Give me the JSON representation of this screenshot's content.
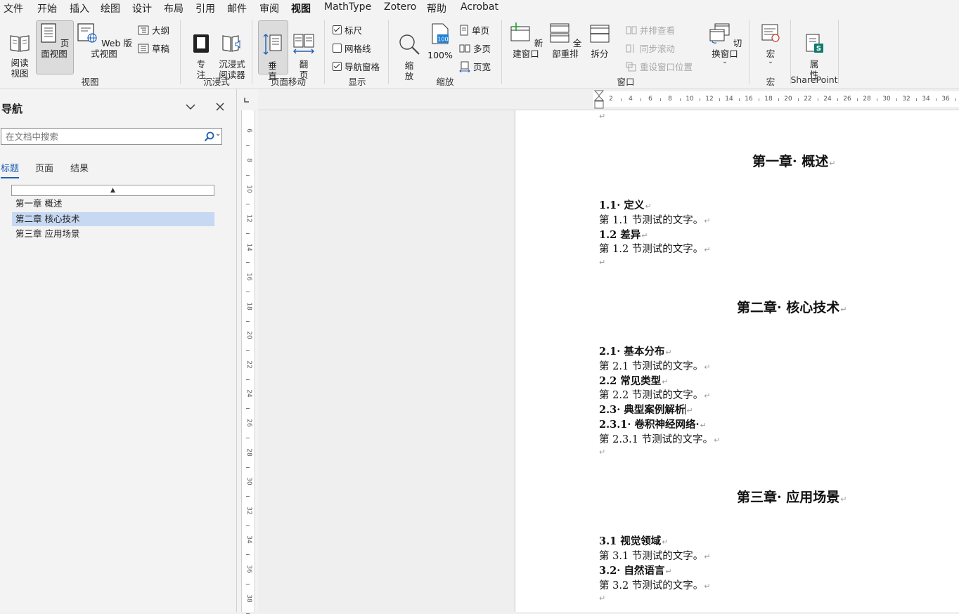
{
  "menu": [
    "文件",
    "开始",
    "插入",
    "绘图",
    "设计",
    "布局",
    "引用",
    "邮件",
    "审阅",
    "视图",
    "MathType",
    "Zotero",
    "帮助",
    "Acrobat"
  ],
  "menu_active_index": 9,
  "ribbon": {
    "view_group": {
      "read_mode": "阅读\n视图",
      "print_layout": "页面视图",
      "web_layout": "Web 版式视图",
      "outline": "大纲",
      "draft": "草稿",
      "label": "视图"
    },
    "immersive_group": {
      "focus": "专\n注",
      "immersive_reader": "沉浸式\n阅读器",
      "label": "沉浸式"
    },
    "page_move_group": {
      "vertical": "垂\n直",
      "side_to_side": "翻\n页",
      "label": "页面移动"
    },
    "show_group": {
      "ruler": "标尺",
      "ruler_checked": true,
      "gridlines": "网格线",
      "gridlines_checked": false,
      "nav_pane": "导航窗格",
      "nav_pane_checked": true,
      "label": "显示"
    },
    "zoom_group": {
      "zoom": "缩\n放",
      "hundred": "100%",
      "hundred_icon": "100",
      "one_page": "单页",
      "multiple_pages": "多页",
      "page_width": "页宽",
      "label": "缩放"
    },
    "window_group": {
      "new_window": "新建窗口",
      "arrange_all": "全部重排",
      "split": "拆分",
      "side_by_side": "并排查看",
      "sync_scroll": "同步滚动",
      "reset_position": "重设窗口位置",
      "switch_windows": "切换窗口",
      "label": "窗口"
    },
    "macro_group": {
      "macros": "宏",
      "label": "宏"
    },
    "sharepoint_group": {
      "properties": "属\n性",
      "label": "SharePoint"
    }
  },
  "nav": {
    "title": "导航",
    "search_placeholder": "在文档中搜索",
    "tabs": [
      "标题",
      "页面",
      "结果"
    ],
    "active_tab": 0,
    "collapse_glyph": "▲",
    "headings": [
      "第一章 概述",
      "第二章 核心技术",
      "第三章 应用场景"
    ],
    "selected_heading": 1
  },
  "vruler_labels": [
    "6",
    "8",
    "10",
    "12",
    "14",
    "16",
    "18",
    "20",
    "22",
    "24",
    "26",
    "28",
    "30",
    "32",
    "34",
    "36",
    "38"
  ],
  "hruler_labels": [
    "2",
    "4",
    "6",
    "8",
    "10",
    "12",
    "14",
    "16",
    "18",
    "20",
    "22",
    "24",
    "26",
    "28",
    "30",
    "32",
    "34",
    "36"
  ],
  "document": {
    "para_mark": "↵",
    "ch1": "第一章· 概述",
    "s1_1": "1.1· 定义",
    "t1_1": "第 1.1 节测试的文字。",
    "s1_2": "1.2 差异",
    "t1_2": "第 1.2 节测试的文字。",
    "ch2": "第二章· 核心技术",
    "s2_1": "2.1· 基本分布",
    "t2_1": "第 2.1 节测试的文字。",
    "s2_2": "2.2 常见类型",
    "t2_2": "第 2.2 节测试的文字。",
    "s2_3": "2.3· 典型案例解析",
    "s2_3_1": "2.3.1· 卷积神经网络·",
    "t2_3_1": "第 2.3.1 节测试的文字。",
    "ch3": "第三章· 应用场景",
    "s3_1": "3.1 视觉领域",
    "t3_1": "第 3.1 节测试的文字。",
    "s3_2": "3.2· 自然语言",
    "t3_2": "第 3.2 节测试的文字。"
  }
}
